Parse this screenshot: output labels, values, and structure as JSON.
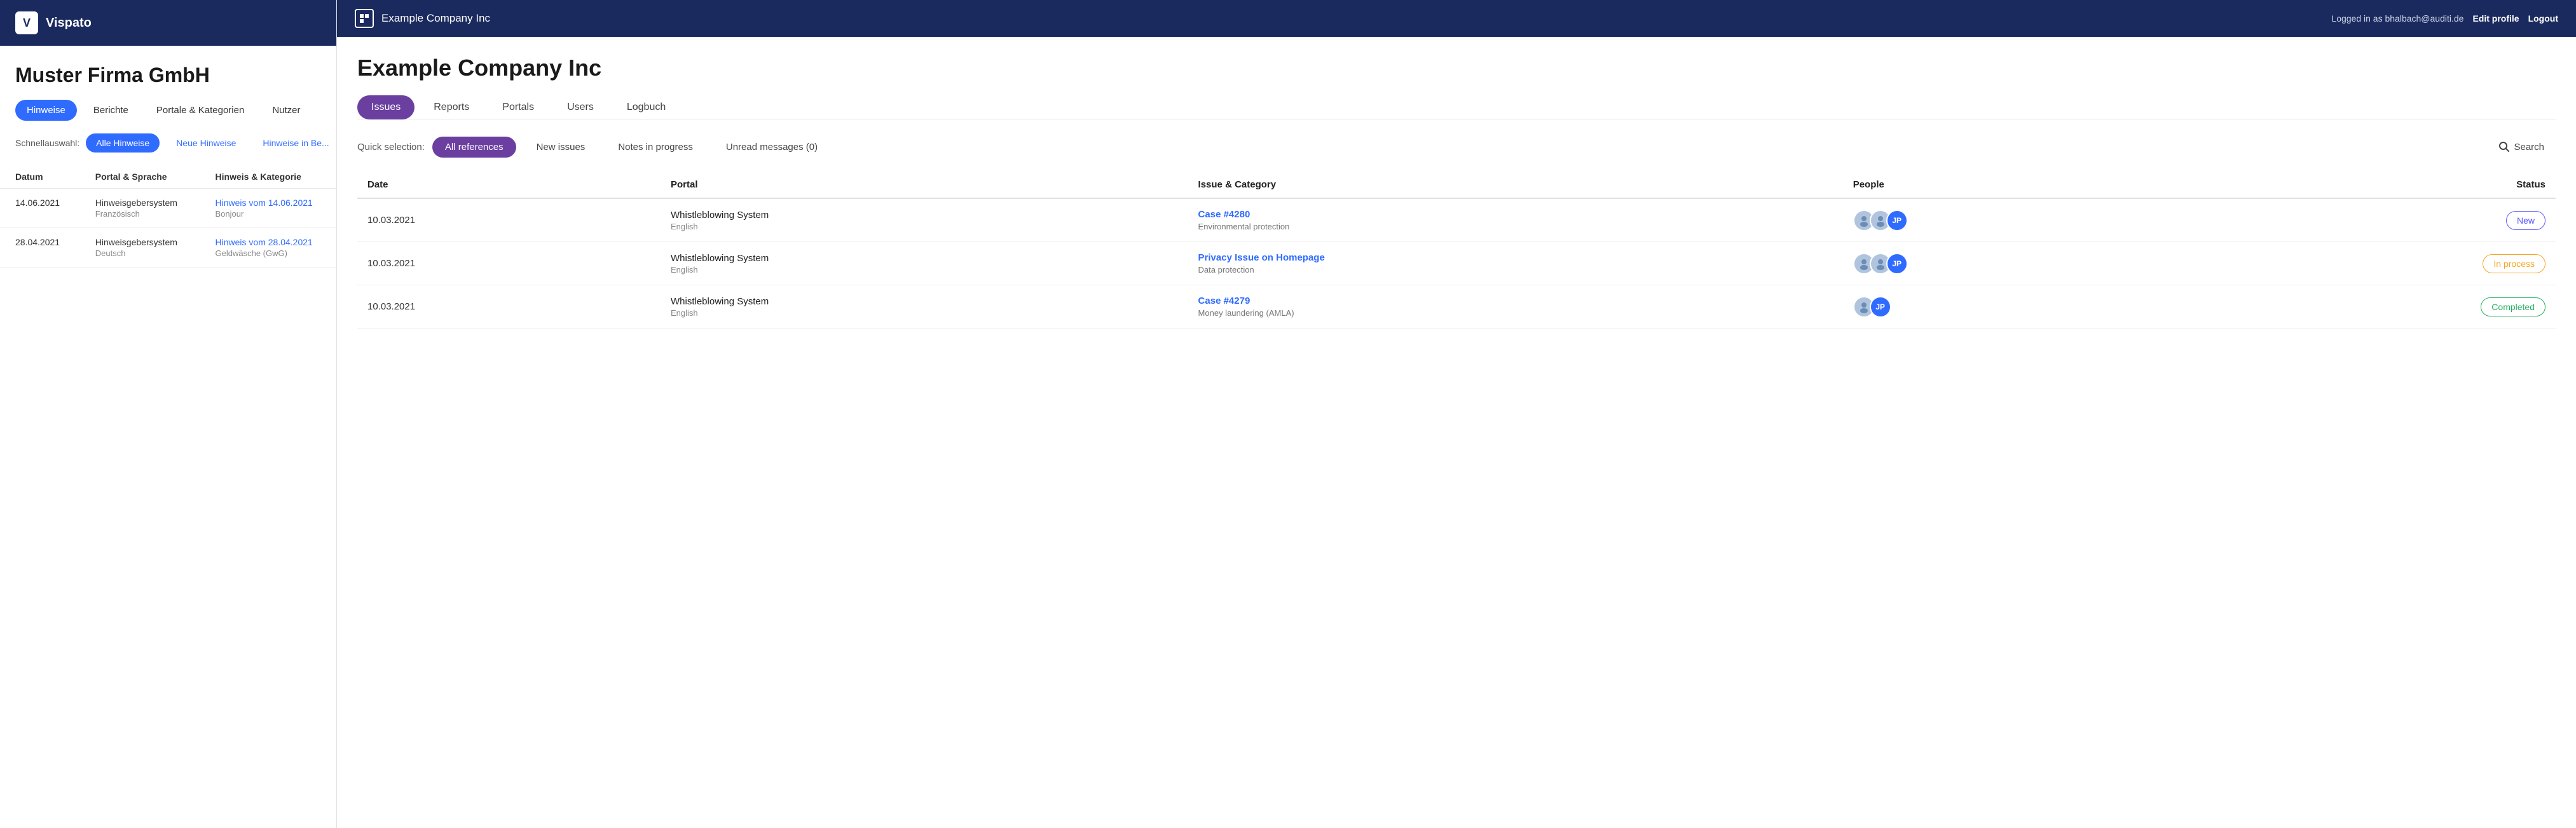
{
  "leftPanel": {
    "logo": "V",
    "brand": "Vispato",
    "companyName": "Muster Firma GmbH",
    "tabs": [
      {
        "id": "hinweise",
        "label": "Hinweise",
        "active": true
      },
      {
        "id": "berichte",
        "label": "Berichte",
        "active": false
      },
      {
        "id": "portale",
        "label": "Portale & Kategorien",
        "active": false
      },
      {
        "id": "nutzer",
        "label": "Nutzer",
        "active": false
      }
    ],
    "quickSelection": {
      "label": "Schnellauswahl:",
      "options": [
        {
          "id": "alle",
          "label": "Alle Hinweise",
          "active": true,
          "style": "active"
        },
        {
          "id": "neue",
          "label": "Neue Hinweise",
          "active": false,
          "style": "text-only"
        },
        {
          "id": "inbearbeitung",
          "label": "Hinweise in Be...",
          "active": false,
          "style": "text-only"
        }
      ]
    },
    "tableHeaders": [
      "Datum",
      "Portal & Sprache",
      "Hinweis & Kategorie"
    ],
    "tableRows": [
      {
        "date": "14.06.2021",
        "portal": "Hinweisgebersystem",
        "language": "Französisch",
        "issueLink": "Hinweis vom 14.06.2021",
        "issueSub": "Bonjour"
      },
      {
        "date": "28.04.2021",
        "portal": "Hinweisgebersystem",
        "language": "Deutsch",
        "issueLink": "Hinweis vom 28.04.2021",
        "issueSub": "Geldwäsche (GwG)"
      }
    ]
  },
  "rightPanel": {
    "topbar": {
      "companyName": "Example Company Inc",
      "loggedInText": "Logged in as bhalbach@auditi.de",
      "editProfile": "Edit profile",
      "logout": "Logout"
    },
    "companyTitle": "Example Company Inc",
    "tabs": [
      {
        "id": "issues",
        "label": "Issues",
        "active": true
      },
      {
        "id": "reports",
        "label": "Reports",
        "active": false
      },
      {
        "id": "portals",
        "label": "Portals",
        "active": false
      },
      {
        "id": "users",
        "label": "Users",
        "active": false
      },
      {
        "id": "logbuch",
        "label": "Logbuch",
        "active": false
      }
    ],
    "quickSelection": {
      "label": "Quick selection:",
      "options": [
        {
          "id": "allrefs",
          "label": "All references",
          "active": true
        },
        {
          "id": "newissues",
          "label": "New issues",
          "active": false
        },
        {
          "id": "notesinprogress",
          "label": "Notes in progress",
          "active": false
        },
        {
          "id": "unread",
          "label": "Unread messages (0)",
          "active": false
        }
      ]
    },
    "searchLabel": "Search",
    "tableHeaders": {
      "date": "Date",
      "portal": "Portal",
      "issueCategory": "Issue & Category",
      "people": "People",
      "status": "Status"
    },
    "tableRows": [
      {
        "date": "10.03.2021",
        "portal": "Whistleblowing System",
        "portalLang": "English",
        "issueName": "Case #4280",
        "issueCategory": "Environmental protection",
        "people": [
          {
            "type": "person",
            "initials": ""
          },
          {
            "type": "person2",
            "initials": ""
          },
          {
            "type": "jp",
            "initials": "JP"
          }
        ],
        "status": "New",
        "statusClass": "badge-new"
      },
      {
        "date": "10.03.2021",
        "portal": "Whistleblowing System",
        "portalLang": "English",
        "issueName": "Privacy Issue on Homepage",
        "issueCategory": "Data protection",
        "people": [
          {
            "type": "person",
            "initials": ""
          },
          {
            "type": "person2",
            "initials": ""
          },
          {
            "type": "jp",
            "initials": "JP"
          }
        ],
        "status": "In process",
        "statusClass": "badge-inprocess"
      },
      {
        "date": "10.03.2021",
        "portal": "Whistleblowing System",
        "portalLang": "English",
        "issueName": "Case #4279",
        "issueCategory": "Money laundering (AMLA)",
        "people": [
          {
            "type": "person",
            "initials": ""
          },
          {
            "type": "jp",
            "initials": "JP"
          }
        ],
        "status": "Completed",
        "statusClass": "badge-completed"
      }
    ]
  }
}
